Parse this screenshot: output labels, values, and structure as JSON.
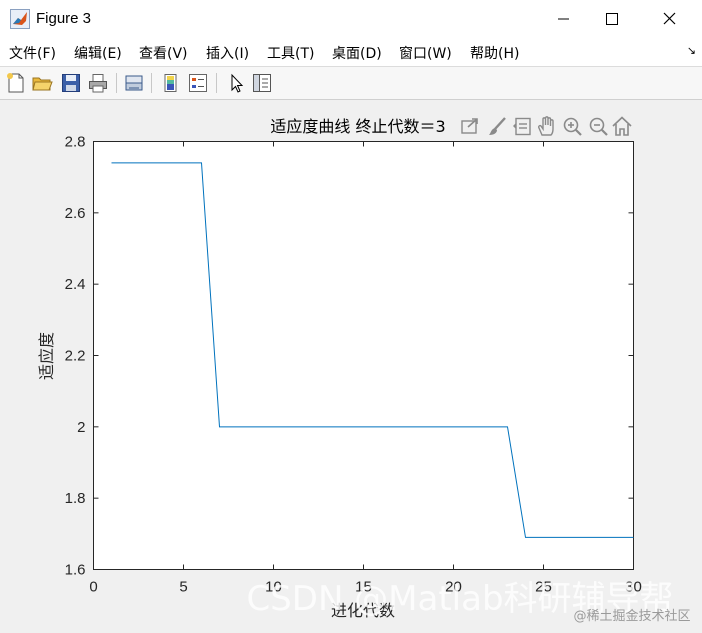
{
  "window": {
    "title": "Figure 3"
  },
  "menu": {
    "items": [
      "文件(F)",
      "编辑(E)",
      "查看(V)",
      "插入(I)",
      "工具(T)",
      "桌面(D)",
      "窗口(W)",
      "帮助(H)"
    ]
  },
  "toolbar": {
    "icons": [
      "new-figure-icon",
      "open-file-icon",
      "save-icon",
      "print-icon",
      "link-plot-icon",
      "insert-colorbar-icon",
      "insert-legend-icon",
      "edit-plot-cursor-icon",
      "property-inspector-icon"
    ]
  },
  "axes_toolbar": {
    "icons": [
      "export-icon",
      "brush-icon",
      "data-tips-icon",
      "pan-hand-icon",
      "zoom-in-icon",
      "zoom-out-icon",
      "home-icon"
    ]
  },
  "chart_data": {
    "type": "line",
    "title": "适应度曲线  终止代数＝3",
    "xlabel": "进化代数",
    "ylabel": "适应度",
    "xlim": [
      0,
      30
    ],
    "ylim": [
      1.6,
      2.8
    ],
    "xticks": [
      "0",
      "5",
      "10",
      "15",
      "20",
      "25",
      "30"
    ],
    "yticks": [
      "1.6",
      "1.8",
      "2",
      "2.2",
      "2.4",
      "2.6",
      "2.8"
    ],
    "grid": false,
    "series_color": "#0072bd",
    "series": [
      {
        "x": [
          1,
          2,
          3,
          4,
          5,
          6,
          7,
          8,
          9,
          10,
          11,
          12,
          13,
          14,
          15,
          16,
          17,
          18,
          19,
          20,
          21,
          22,
          23,
          24,
          25,
          26,
          27,
          28,
          29,
          30
        ],
        "values": [
          2.74,
          2.74,
          2.74,
          2.74,
          2.74,
          2.74,
          2.0,
          2.0,
          2.0,
          2.0,
          2.0,
          2.0,
          2.0,
          2.0,
          2.0,
          2.0,
          2.0,
          2.0,
          2.0,
          2.0,
          2.0,
          2.0,
          2.0,
          1.69,
          1.69,
          1.69,
          1.69,
          1.69,
          1.69,
          1.69
        ]
      }
    ]
  },
  "watermark": {
    "main": "CSDN @Matlab科研辅导帮",
    "secondary": "@稀土掘金技术社区"
  }
}
